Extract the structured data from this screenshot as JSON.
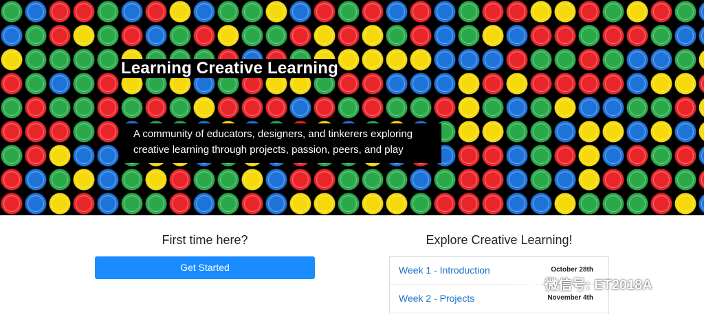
{
  "hero": {
    "title": "Learning Creative Learning",
    "tagline_line1": "A community of educators, designers, and tinkerers exploring",
    "tagline_line2": "creative learning through projects, passion, peers, and play",
    "dot_colors": [
      "#e8262a",
      "#2aa84a",
      "#1e73d8",
      "#f5d90a"
    ]
  },
  "left": {
    "heading": "First time here?",
    "button_label": "Get Started",
    "button_color": "#1a8cff"
  },
  "right": {
    "heading": "Explore Creative Learning!",
    "weeks": [
      {
        "label": "Week 1 - Introduction",
        "date": "October 28th"
      },
      {
        "label": "Week 2 - Projects",
        "date": "November 4th"
      }
    ]
  },
  "watermark": {
    "text": "微信号: ET2018A",
    "icon": "wechat-icon"
  }
}
